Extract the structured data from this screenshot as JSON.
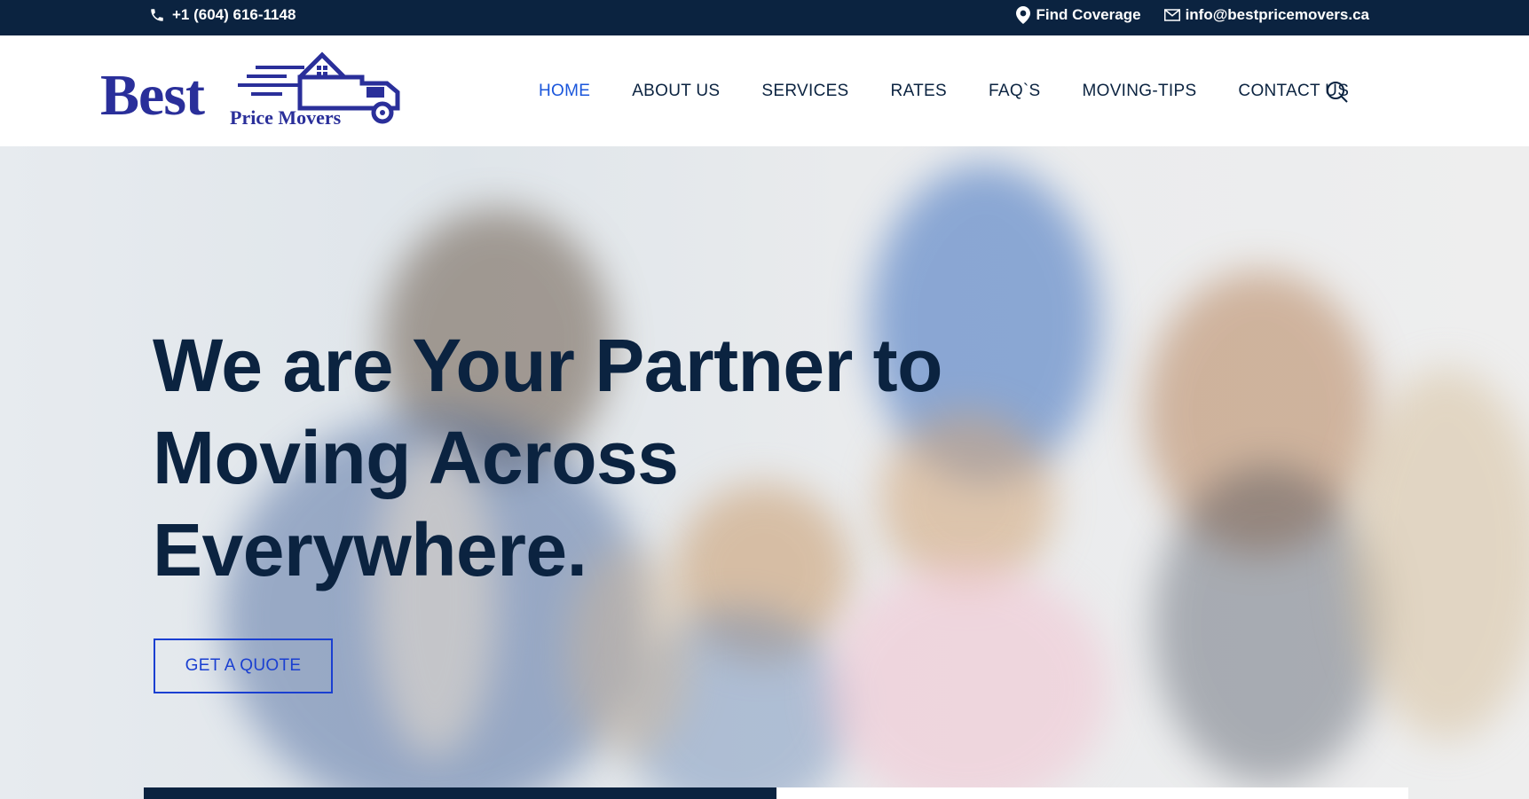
{
  "topbar": {
    "phone": "+1 (604) 616-1148",
    "find_coverage": "Find Coverage",
    "email": "info@bestpricemovers.ca"
  },
  "logo": {
    "word_best": "Best",
    "word_price_movers": "Price Movers"
  },
  "nav": {
    "items": [
      {
        "label": "HOME",
        "active": true
      },
      {
        "label": "ABOUT US"
      },
      {
        "label": "SERVICES"
      },
      {
        "label": "RATES"
      },
      {
        "label": "FAQ`S"
      },
      {
        "label": "MOVING-TIPS"
      },
      {
        "label": "CONTACT US"
      }
    ],
    "search_icon": "search-icon"
  },
  "hero": {
    "title_line1": "We are Your Partner to",
    "title_line2": "Moving Across",
    "title_line3": "Everywhere.",
    "cta_label": "GET A QUOTE"
  },
  "colors": {
    "navy": "#0b2340",
    "brand_blue": "#2a2f9a",
    "active_link": "#1a56db",
    "cta_border": "#1a3fd1"
  }
}
